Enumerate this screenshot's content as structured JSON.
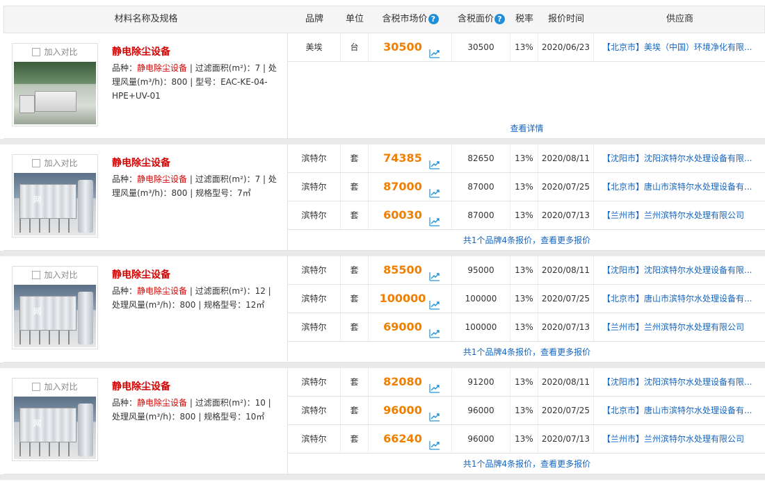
{
  "columns": {
    "name": "材料名称及规格",
    "brand": "品牌",
    "unit": "单位",
    "market_price": "含税市场价",
    "face_price": "含税面价",
    "tax_rate": "税率",
    "quote_time": "报价时间",
    "supplier": "供应商"
  },
  "compare_label": "加入对比",
  "watermark": "网",
  "products": [
    {
      "title": "静电除尘设备",
      "spec_prefix": "品种：",
      "spec_variety": "静电除尘设备",
      "spec_rest": " | 过滤面积(m²)：7 | 处理风量(m³/h)：800 | 型号：EAC-KE-04-HPE+UV-01",
      "quotes": [
        {
          "brand": "美埃",
          "unit": "台",
          "market": "30500",
          "face": "30500",
          "tax": "13%",
          "date": "2020/06/23",
          "supplier": "【北京市】美埃（中国）环境净化有限..."
        }
      ],
      "more": "查看详情"
    },
    {
      "title": "静电除尘设备",
      "spec_prefix": "品种：",
      "spec_variety": "静电除尘设备",
      "spec_rest": " | 过滤面积(m²)：7 | 处理风量(m³/h)：800 | 规格型号：7㎡",
      "quotes": [
        {
          "brand": "滨特尔",
          "unit": "套",
          "market": "74385",
          "face": "82650",
          "tax": "13%",
          "date": "2020/08/11",
          "supplier": "【沈阳市】沈阳滨特尔水处理设备有限..."
        },
        {
          "brand": "滨特尔",
          "unit": "套",
          "market": "87000",
          "face": "87000",
          "tax": "13%",
          "date": "2020/07/25",
          "supplier": "【北京市】唐山市滨特尔水处理设备有..."
        },
        {
          "brand": "滨特尔",
          "unit": "套",
          "market": "60030",
          "face": "87000",
          "tax": "13%",
          "date": "2020/07/13",
          "supplier": "【兰州市】兰州滨特尔水处理有限公司"
        }
      ],
      "more": "共1个品牌4条报价，查看更多报价"
    },
    {
      "title": "静电除尘设备",
      "spec_prefix": "品种：",
      "spec_variety": "静电除尘设备",
      "spec_rest": " | 过滤面积(m²)：12 | 处理风量(m³/h)：800 | 规格型号：12㎡",
      "quotes": [
        {
          "brand": "滨特尔",
          "unit": "套",
          "market": "85500",
          "face": "95000",
          "tax": "13%",
          "date": "2020/08/11",
          "supplier": "【沈阳市】沈阳滨特尔水处理设备有限..."
        },
        {
          "brand": "滨特尔",
          "unit": "套",
          "market": "100000",
          "face": "100000",
          "tax": "13%",
          "date": "2020/07/25",
          "supplier": "【北京市】唐山市滨特尔水处理设备有..."
        },
        {
          "brand": "滨特尔",
          "unit": "套",
          "market": "69000",
          "face": "100000",
          "tax": "13%",
          "date": "2020/07/13",
          "supplier": "【兰州市】兰州滨特尔水处理有限公司"
        }
      ],
      "more": "共1个品牌4条报价，查看更多报价"
    },
    {
      "title": "静电除尘设备",
      "spec_prefix": "品种：",
      "spec_variety": "静电除尘设备",
      "spec_rest": " | 过滤面积(m²)：10 | 处理风量(m³/h)：800 | 规格型号：10㎡",
      "quotes": [
        {
          "brand": "滨特尔",
          "unit": "套",
          "market": "82080",
          "face": "91200",
          "tax": "13%",
          "date": "2020/08/11",
          "supplier": "【沈阳市】沈阳滨特尔水处理设备有限..."
        },
        {
          "brand": "滨特尔",
          "unit": "套",
          "market": "96000",
          "face": "96000",
          "tax": "13%",
          "date": "2020/07/25",
          "supplier": "【北京市】唐山市滨特尔水处理设备有..."
        },
        {
          "brand": "滨特尔",
          "unit": "套",
          "market": "66240",
          "face": "96000",
          "tax": "13%",
          "date": "2020/07/13",
          "supplier": "【兰州市】兰州滨特尔水处理有限公司"
        }
      ],
      "more": "共1个品牌4条报价，查看更多报价"
    }
  ],
  "colors": {
    "price": "#f07f00",
    "title_red": "#d40000",
    "link_blue": "#1565c0",
    "help_blue": "#1e8fd8"
  }
}
